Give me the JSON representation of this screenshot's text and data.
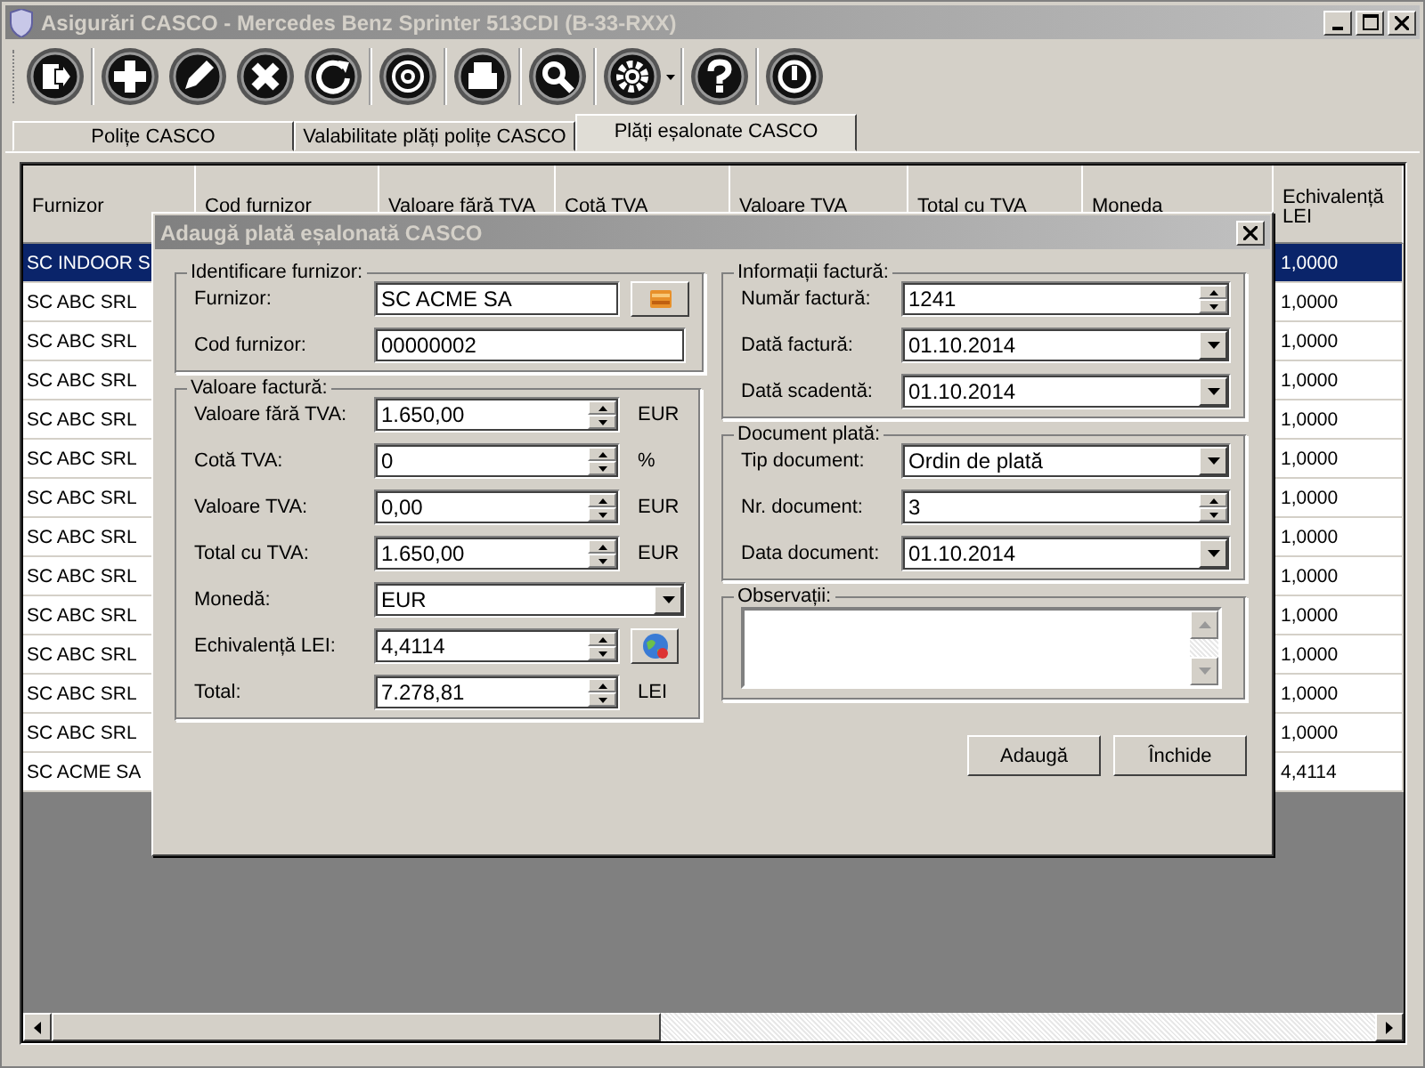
{
  "window": {
    "title": "Asigurări CASCO - Mercedes Benz Sprinter 513CDI (B-33-RXX)"
  },
  "toolbar": [
    [
      {
        "kind": "exit",
        "menu": false
      }
    ],
    [
      {
        "kind": "add",
        "menu": false
      },
      {
        "kind": "edit",
        "menu": false
      },
      {
        "kind": "delete",
        "menu": false
      },
      {
        "kind": "refresh",
        "menu": false
      }
    ],
    [
      {
        "kind": "email",
        "menu": false
      }
    ],
    [
      {
        "kind": "print",
        "menu": false
      }
    ],
    [
      {
        "kind": "search",
        "menu": false
      }
    ],
    [
      {
        "kind": "settings",
        "menu": true
      }
    ],
    [
      {
        "kind": "help",
        "menu": false
      }
    ],
    [
      {
        "kind": "power",
        "menu": false
      }
    ]
  ],
  "tabs": [
    {
      "label": "Polițe CASCO",
      "selected": false
    },
    {
      "label": "Valabilitate plăți polițe CASCO",
      "selected": false
    },
    {
      "label": "Plăți eșalonate CASCO",
      "selected": true
    }
  ],
  "table": {
    "columns": [
      "Furnizor",
      "Cod furnizor",
      "Valoare fără TVA",
      "Cotă TVA",
      "Valoare TVA",
      "Total cu TVA",
      "Moneda",
      "Echivalență LEI"
    ],
    "rows": [
      {
        "furnizor": "SC INDOOR S",
        "echivalenta": "1,0000",
        "selected": true
      },
      {
        "furnizor": "SC ABC SRL",
        "echivalenta": "1,0000",
        "selected": false
      },
      {
        "furnizor": "SC ABC SRL",
        "echivalenta": "1,0000",
        "selected": false
      },
      {
        "furnizor": "SC ABC SRL",
        "echivalenta": "1,0000",
        "selected": false
      },
      {
        "furnizor": "SC ABC SRL",
        "echivalenta": "1,0000",
        "selected": false
      },
      {
        "furnizor": "SC ABC SRL",
        "echivalenta": "1,0000",
        "selected": false
      },
      {
        "furnizor": "SC ABC SRL",
        "echivalenta": "1,0000",
        "selected": false
      },
      {
        "furnizor": "SC ABC SRL",
        "echivalenta": "1,0000",
        "selected": false
      },
      {
        "furnizor": "SC ABC SRL",
        "echivalenta": "1,0000",
        "selected": false
      },
      {
        "furnizor": "SC ABC SRL",
        "echivalenta": "1,0000",
        "selected": false
      },
      {
        "furnizor": "SC ABC SRL",
        "echivalenta": "1,0000",
        "selected": false
      },
      {
        "furnizor": "SC ABC SRL",
        "echivalenta": "1,0000",
        "selected": false
      },
      {
        "furnizor": "SC ABC SRL",
        "echivalenta": "1,0000",
        "selected": false
      },
      {
        "furnizor": "SC ACME SA",
        "echivalenta": "4,4114",
        "selected": false
      }
    ]
  },
  "dialog": {
    "title": "Adaugă plată eșalonată CASCO",
    "columns": [
      [
        {
          "title": "Identificare furnizor:",
          "fields": [
            {
              "label": "Furnizor:",
              "value": "SC ACME SA",
              "kind": "text",
              "button": {
                "kind": "picker"
              }
            },
            {
              "label": "Cod furnizor:",
              "value": "00000002",
              "kind": "text"
            }
          ]
        },
        {
          "title": "Valoare factură:",
          "fields": [
            {
              "label": "Valoare fără TVA:",
              "value": "1.650,00",
              "kind": "spin",
              "unit": "EUR"
            },
            {
              "label": "Cotă TVA:",
              "value": "0",
              "kind": "spin",
              "unit": "%"
            },
            {
              "label": "Valoare TVA:",
              "value": "0,00",
              "kind": "spin",
              "unit": "EUR"
            },
            {
              "label": "Total cu TVA:",
              "value": "1.650,00",
              "kind": "spin",
              "unit": "EUR"
            },
            {
              "label": "Monedă:",
              "value": "EUR",
              "kind": "combo"
            },
            {
              "label": "Echivalență LEI:",
              "value": "4,4114",
              "kind": "spin",
              "button": {
                "kind": "globe"
              }
            },
            {
              "label": "Total:",
              "value": "7.278,81",
              "kind": "spin",
              "unit": "LEI"
            }
          ]
        }
      ],
      [
        {
          "title": "Informații factură:",
          "fields": [
            {
              "label": "Număr factură:",
              "value": "1241",
              "kind": "spin"
            },
            {
              "label": "Dată factură:",
              "value": "01.10.2014",
              "kind": "combo"
            },
            {
              "label": "Dată scadentă:",
              "value": "01.10.2014",
              "kind": "combo"
            }
          ]
        },
        {
          "title": "Document plată:",
          "fields": [
            {
              "label": "Tip document:",
              "value": "Ordin de plată",
              "kind": "combo"
            },
            {
              "label": "Nr. document:",
              "value": "3",
              "kind": "spin"
            },
            {
              "label": "Data document:",
              "value": "01.10.2014",
              "kind": "combo"
            }
          ]
        },
        {
          "title": "Observații:",
          "fields": [
            {
              "kind": "memo"
            }
          ]
        }
      ]
    ],
    "buttons": [
      "Adaugă",
      "Închide"
    ]
  }
}
